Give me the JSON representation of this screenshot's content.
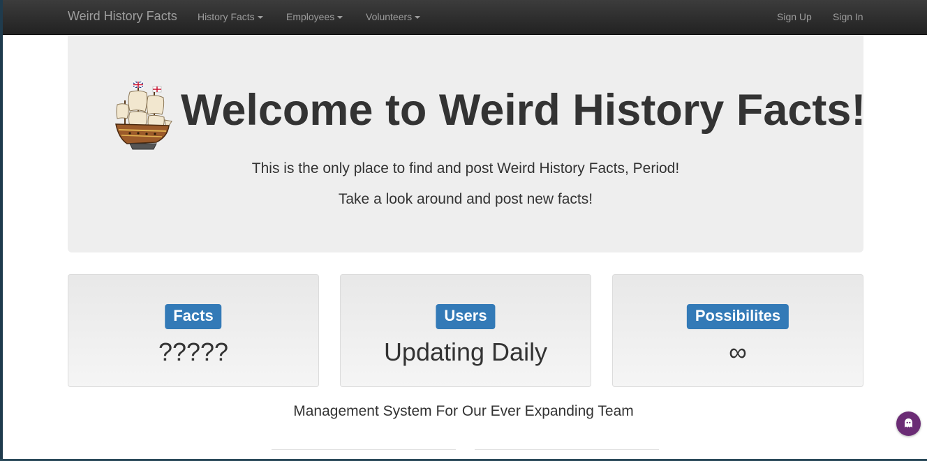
{
  "navbar": {
    "brand": "Weird History Facts",
    "menus": [
      {
        "label": "History Facts"
      },
      {
        "label": "Employees"
      },
      {
        "label": "Volunteers"
      }
    ],
    "sign_up": "Sign Up",
    "sign_in": "Sign In"
  },
  "hero": {
    "title": "Welcome to Weird History Facts!",
    "lead_1": "This is the only place to find and post Weird History Facts, Period!",
    "lead_2": "Take a look around and post new facts!",
    "logo_icon": "sailing-ship-icon"
  },
  "stats": [
    {
      "label": "Facts",
      "value": "?????"
    },
    {
      "label": "Users",
      "value": "Updating Daily"
    },
    {
      "label": "Possibilites",
      "value": "∞"
    }
  ],
  "team_text": "Management System For Our Ever Expanding Team",
  "chat_widget": {
    "icon": "ghost-chat-icon"
  },
  "colors": {
    "navbar_bg": "#222222",
    "nav_text": "#9d9d9d",
    "jumbotron_bg": "#eeeeee",
    "label_bg": "#337ab7",
    "chat_bg": "#6b2c75"
  }
}
